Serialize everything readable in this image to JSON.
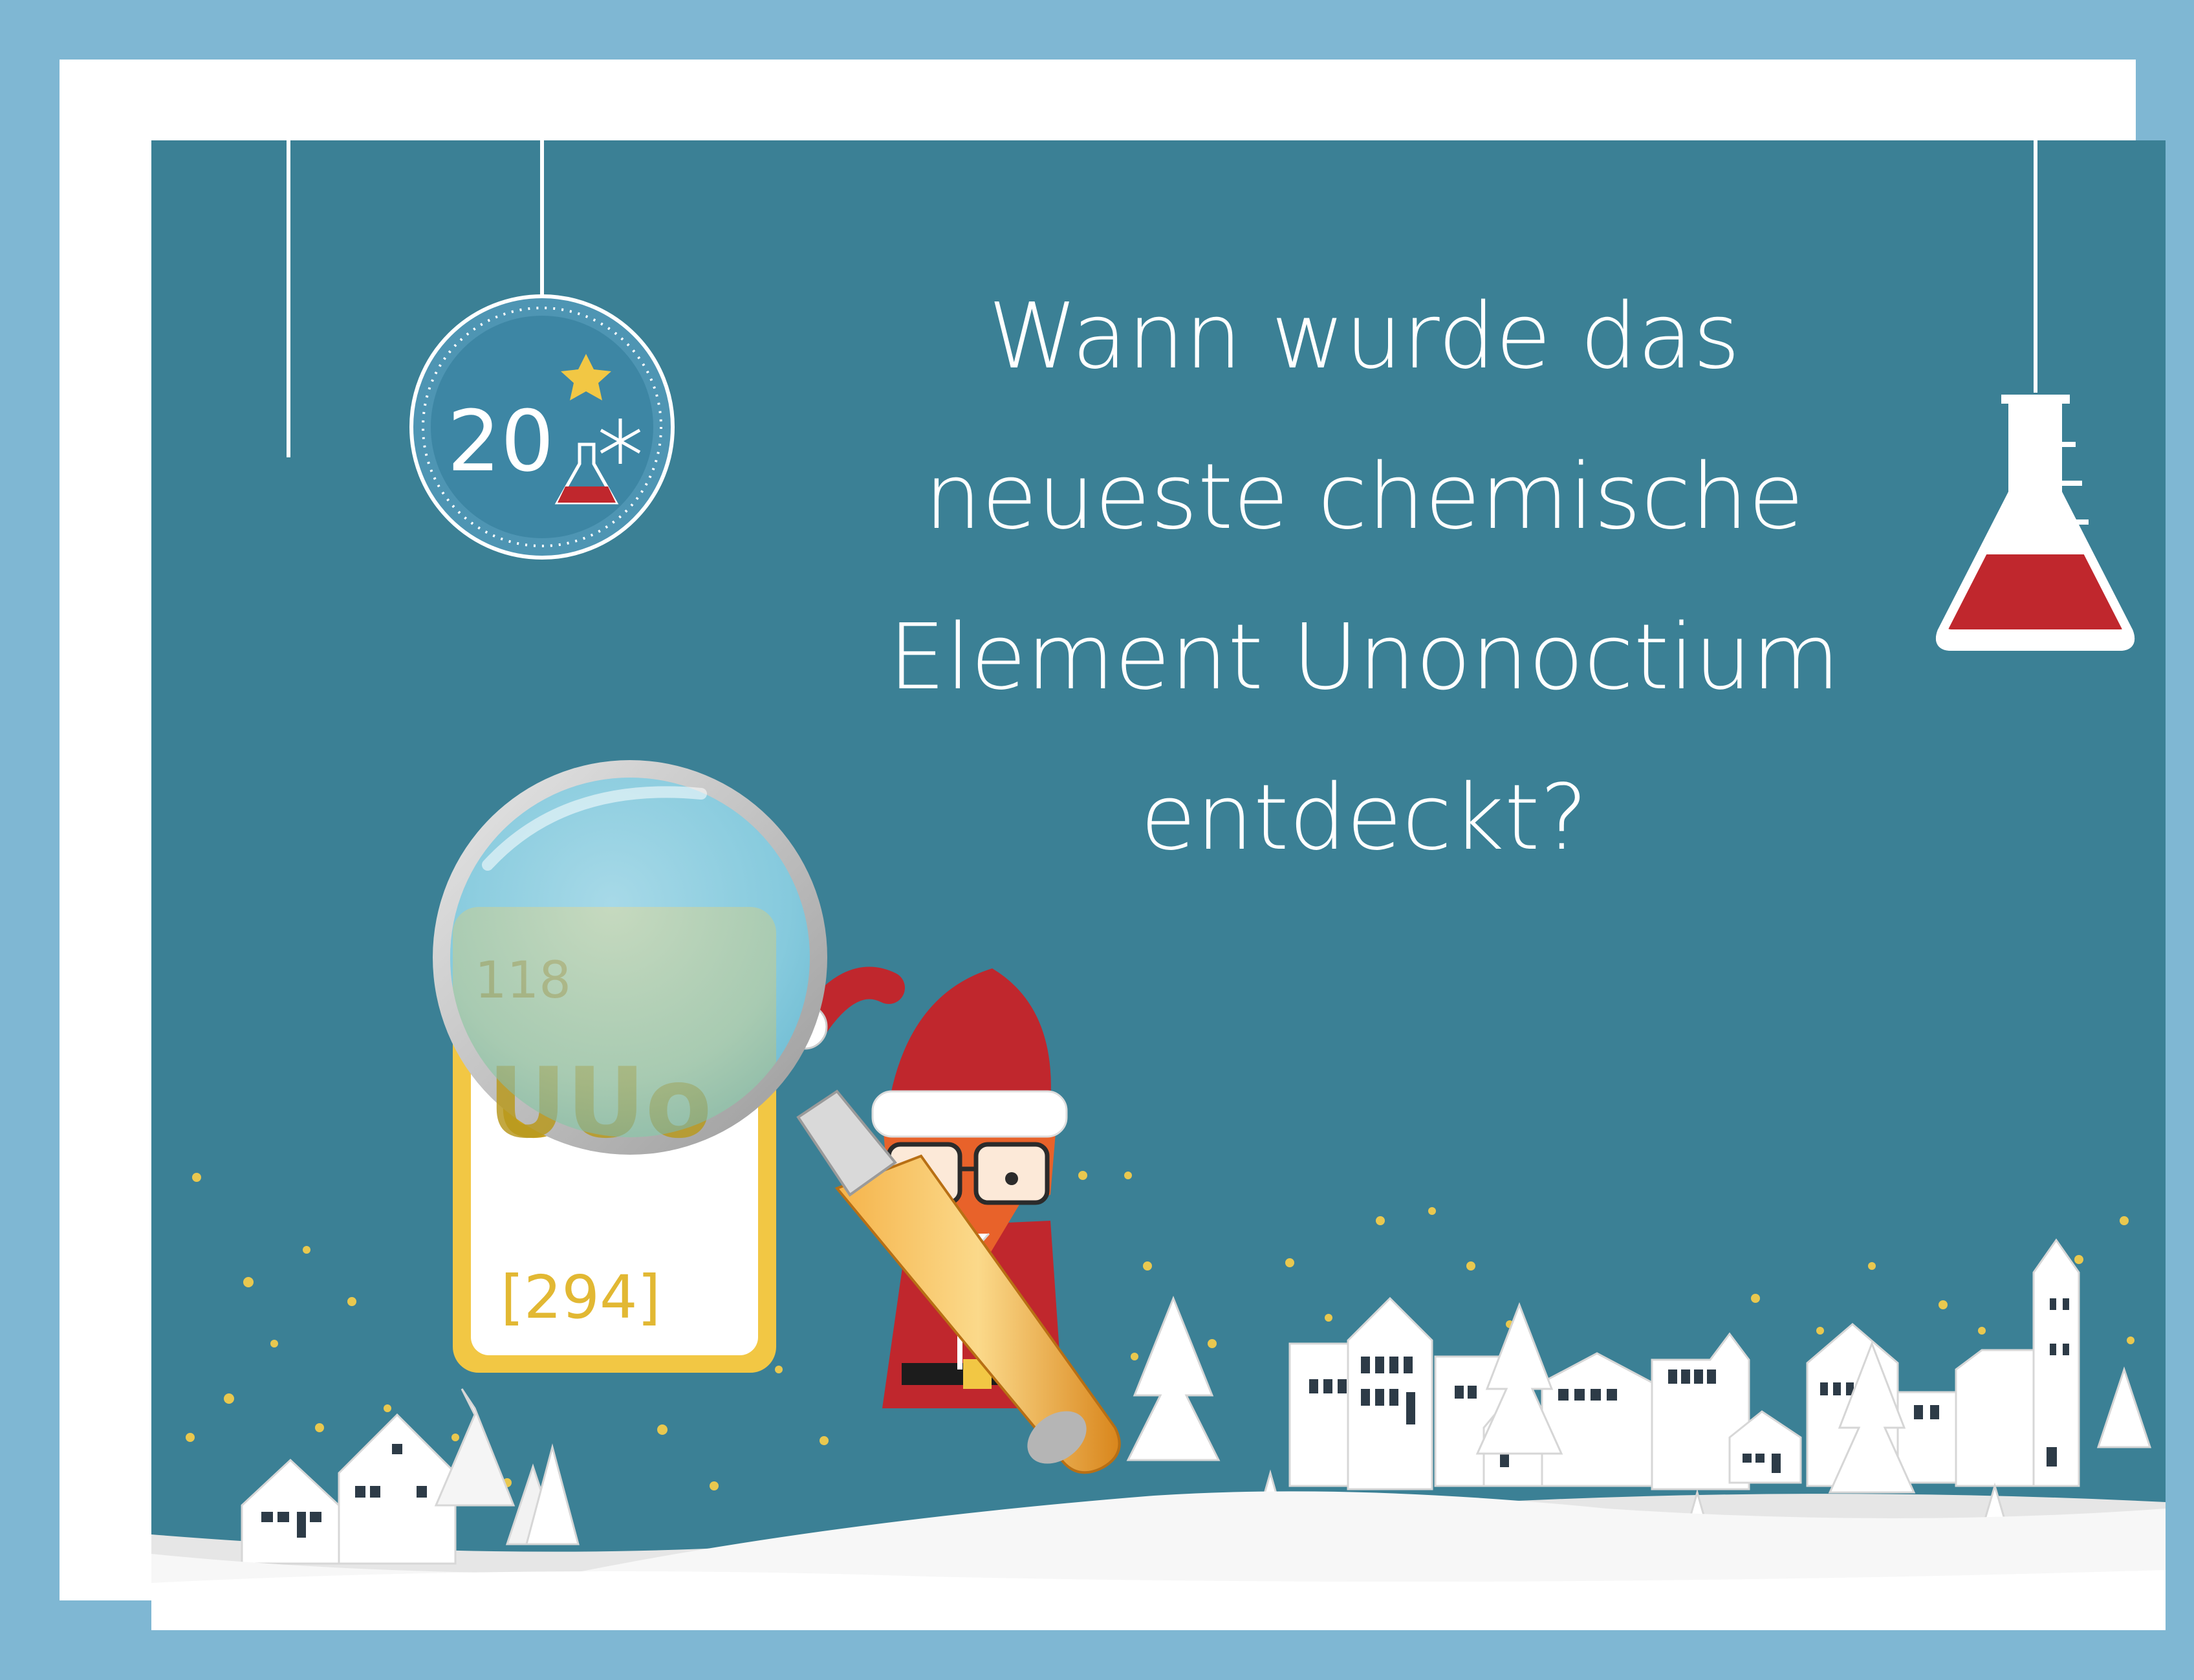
{
  "question": {
    "lines": [
      "Wann wurde das",
      "neueste chemische",
      "Element Unonoctium",
      "entdeckt?"
    ]
  },
  "ornament": {
    "day": "20"
  },
  "element_card": {
    "number": "118",
    "symbol": "UUo",
    "mass": "[294]"
  },
  "colors": {
    "outer_border": "#7fb7d3",
    "inner_border": "#ffffff",
    "background": "#3b8095",
    "flask_liquid": "#c0272d",
    "card_gold": "#f2c744",
    "star": "#e9c84f"
  },
  "icons": [
    "ornament-day-icon",
    "flask-icon",
    "magnifying-glass-icon",
    "fox-santa-icon",
    "snowflake-icon",
    "star-icon"
  ]
}
